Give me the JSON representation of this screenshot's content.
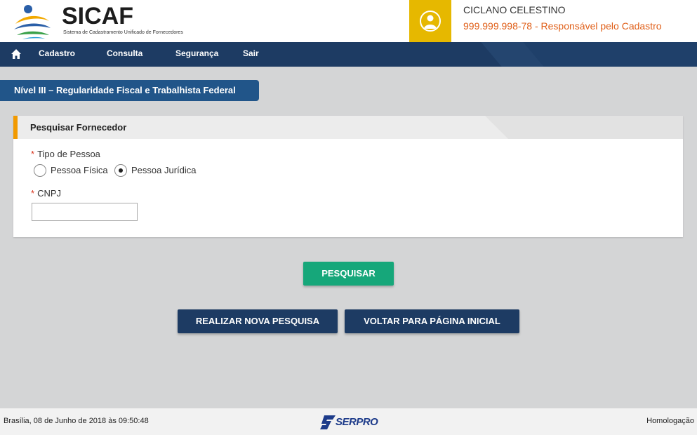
{
  "header": {
    "app_name": "SICAF",
    "app_subtitle": "Sistema de Cadastramento Unificado de Fornecedores",
    "user_name": "CICLANO CELESTINO",
    "user_role": "999.999.998-78 - Responsável pelo Cadastro"
  },
  "nav": {
    "items": [
      {
        "label": "Cadastro"
      },
      {
        "label": "Consulta"
      },
      {
        "label": "Segurança"
      },
      {
        "label": "Sair"
      }
    ]
  },
  "page": {
    "title": "Nível III – Regularidade Fiscal e Trabalhista Federal"
  },
  "search_card": {
    "title": "Pesquisar Fornecedor",
    "tipo_pessoa": {
      "required_mark": "*",
      "label": "Tipo de Pessoa",
      "options": [
        {
          "label": "Pessoa Física",
          "checked": false
        },
        {
          "label": "Pessoa Jurídica",
          "checked": true
        }
      ]
    },
    "cnpj": {
      "required_mark": "*",
      "label": "CNPJ",
      "value": ""
    }
  },
  "actions": {
    "search_label": "PESQUISAR",
    "new_search_label": "REALIZAR NOVA PESQUISA",
    "home_label": "VOLTAR PARA PÁGINA INICIAL"
  },
  "footer": {
    "datetime": "Brasília, 08 de Junho de 2018 às 09:50:48",
    "brand": "SERPRO",
    "environment": "Homologação"
  },
  "colors": {
    "nav_bg": "#1d3b63",
    "title_tab_bg": "#215589",
    "user_box": "#e6b800",
    "accent_orange": "#f29a00",
    "role_text": "#e0601a",
    "search_button": "#16a77a",
    "page_bg": "#d4d5d6"
  },
  "icons": {
    "logo": "sicaf-logo-icon",
    "user": "user-icon",
    "home": "home-icon",
    "footer_brand": "serpro-logo-icon"
  }
}
